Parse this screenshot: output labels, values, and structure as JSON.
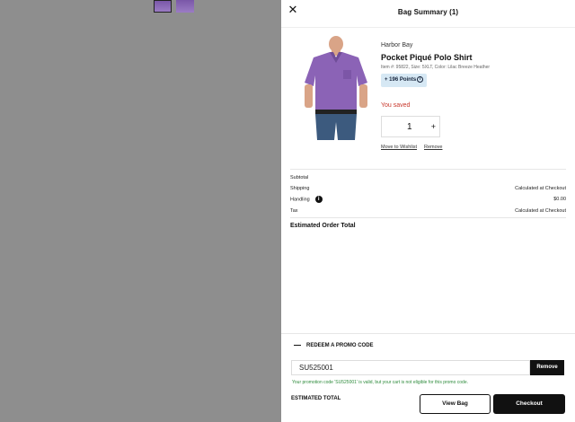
{
  "drawer": {
    "title": "Bag Summary (1)",
    "close_icon": "close-icon"
  },
  "item": {
    "brand": "Harbor Bay",
    "name": "Pocket Piqué Polo Shirt",
    "meta": "Item #: 95822, Size: 5XLT, Color: Lilac Breeze Heather",
    "points": "+ 196 Points",
    "saved": "You saved",
    "quantity": "1",
    "plus": "+",
    "move_to_wishlist": "Move to Wishlist",
    "remove": "Remove",
    "shirt_color": "#8b63b6"
  },
  "summary": {
    "subtotal_label": "Subtotal",
    "shipping_label": "Shipping",
    "shipping_value": "Calculated at Checkout",
    "handling_label": "Handling",
    "handling_value": "$0.00",
    "tax_label": "Tax",
    "tax_value": "Calculated at Checkout",
    "estimated_total": "Estimated Order Total"
  },
  "promo": {
    "toggle_label": "REDEEM A PROMO CODE",
    "code": "SU525001",
    "remove_label": "Remove",
    "message": "Your promotion code 'SU525001' is valid, but your cart is not eligible for this promo code."
  },
  "footer": {
    "estimated_total": "ESTIMATED TOTAL",
    "view_bag": "View Bag",
    "checkout": "Checkout"
  },
  "colors": {
    "accent_red": "#c8372b",
    "success_green": "#2e8b3c",
    "points_bg": "#d6e8f4"
  }
}
